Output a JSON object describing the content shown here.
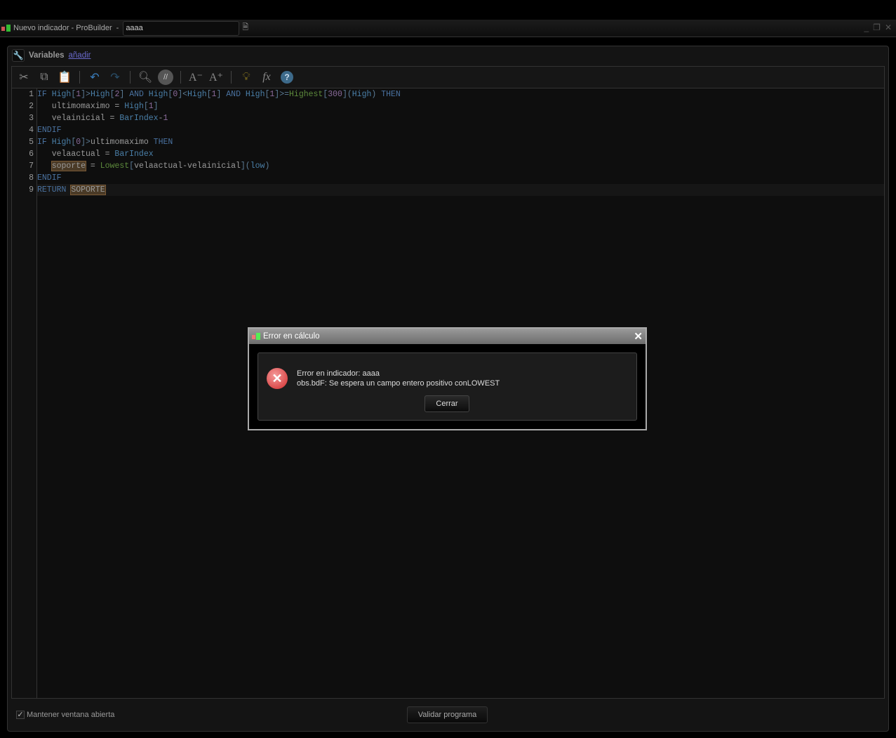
{
  "window": {
    "title": "Nuevo indicador - ProBuilder",
    "separator": "-",
    "name_value": "aaaa"
  },
  "variables": {
    "label": "Variables",
    "add_link": "añadir"
  },
  "toolbar": [
    "cut-icon",
    "copy-icon",
    "paste-icon",
    "undo-icon",
    "redo-icon",
    "search-icon",
    "comment-icon",
    "font-decrease-icon",
    "font-increase-icon",
    "lightbulb-icon",
    "function-icon",
    "help-icon"
  ],
  "code": {
    "lines": [
      [
        [
          "IF ",
          "kw"
        ],
        [
          "High",
          "bi"
        ],
        [
          "[",
          "br"
        ],
        [
          "1",
          "num"
        ],
        [
          "]>",
          "br"
        ],
        [
          "High",
          "bi"
        ],
        [
          "[",
          "br"
        ],
        [
          "2",
          "num"
        ],
        [
          "] ",
          "br"
        ],
        [
          "AND ",
          "kw"
        ],
        [
          "High",
          "bi"
        ],
        [
          "[",
          "br"
        ],
        [
          "0",
          "num"
        ],
        [
          "]<",
          "br"
        ],
        [
          "High",
          "bi"
        ],
        [
          "[",
          "br"
        ],
        [
          "1",
          "num"
        ],
        [
          "] ",
          "br"
        ],
        [
          "AND ",
          "kw"
        ],
        [
          "High",
          "bi"
        ],
        [
          "[",
          "br"
        ],
        [
          "1",
          "num"
        ],
        [
          "]>=",
          "br"
        ],
        [
          "Highest",
          "fn"
        ],
        [
          "[",
          "br"
        ],
        [
          "300",
          "num"
        ],
        [
          "](",
          "br"
        ],
        [
          "High",
          "bi"
        ],
        [
          ") ",
          "br"
        ],
        [
          "THEN",
          "kw"
        ]
      ],
      [
        [
          "   ultimomaximo = ",
          "var"
        ],
        [
          "High",
          "bi"
        ],
        [
          "[",
          "br"
        ],
        [
          "1",
          "num"
        ],
        [
          "]",
          "br"
        ]
      ],
      [
        [
          "   velainicial = ",
          "var"
        ],
        [
          "BarIndex",
          "bi"
        ],
        [
          "-",
          "op"
        ],
        [
          "1",
          "num"
        ]
      ],
      [
        [
          "ENDIF",
          "kw"
        ]
      ],
      [
        [
          "IF ",
          "kw"
        ],
        [
          "High",
          "bi"
        ],
        [
          "[",
          "br"
        ],
        [
          "0",
          "num"
        ],
        [
          "]>",
          "br"
        ],
        [
          "ultimomaximo ",
          "var"
        ],
        [
          "THEN",
          "kw"
        ]
      ],
      [
        [
          "   velaactual = ",
          "var"
        ],
        [
          "BarIndex",
          "bi"
        ]
      ],
      [
        [
          "   ",
          "var"
        ],
        [
          "soporte",
          "var-hl"
        ],
        [
          " = ",
          "var"
        ],
        [
          "Lowest",
          "fn"
        ],
        [
          "[",
          "br"
        ],
        [
          "velaactual-velainicial",
          "var"
        ],
        [
          "](",
          "br"
        ],
        [
          "low",
          "bi"
        ],
        [
          ")",
          "br"
        ]
      ],
      [
        [
          "ENDIF",
          "kw"
        ]
      ],
      [
        [
          "RETURN ",
          "kw"
        ],
        [
          "SOPORTE",
          "var-hl"
        ]
      ]
    ]
  },
  "footer": {
    "keep_open": "Mantener ventana abierta",
    "keep_open_checked": true,
    "validate": "Validar programa"
  },
  "dialog": {
    "title": "Error en cálculo",
    "line1": "Error en indicador: aaaa",
    "line2": "obs.bdF: Se espera un campo entero positivo conLOWEST",
    "close_button": "Cerrar"
  }
}
